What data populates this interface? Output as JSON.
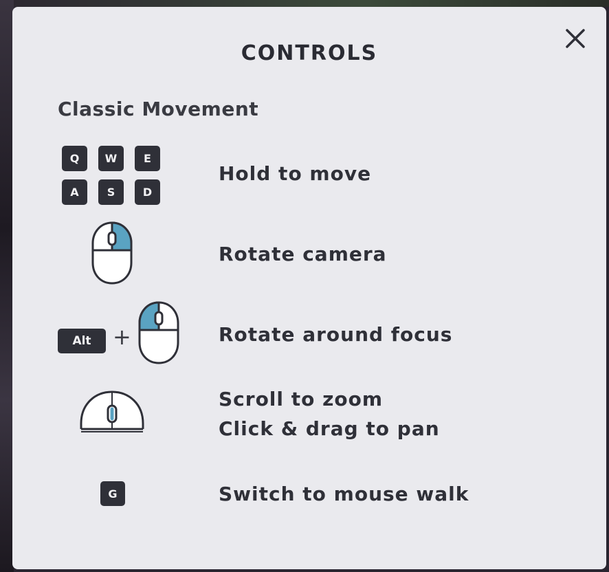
{
  "dialog": {
    "title": "CONTROLS",
    "close_glyph": "×"
  },
  "section": {
    "title": "Classic Movement"
  },
  "controls": [
    {
      "keys": [
        "Q",
        "W",
        "E",
        "A",
        "S",
        "D"
      ],
      "label": "Hold to move",
      "icon": "wasd-keys-icon"
    },
    {
      "label": "Rotate camera",
      "icon": "mouse-right-click-icon"
    },
    {
      "modifier": "Alt",
      "plus": "+",
      "label": "Rotate around focus",
      "icon": "mouse-right-click-icon"
    },
    {
      "label_line1": "Scroll to zoom",
      "label_line2": "Click & drag to pan",
      "icon": "mouse-wheel-icon"
    },
    {
      "key": "G",
      "label": "Switch to mouse walk",
      "icon": "g-key-icon"
    }
  ],
  "colors": {
    "panel_bg": "#eaeaee",
    "key_bg": "#2f3038",
    "accent_click": "#5aa3c2"
  }
}
